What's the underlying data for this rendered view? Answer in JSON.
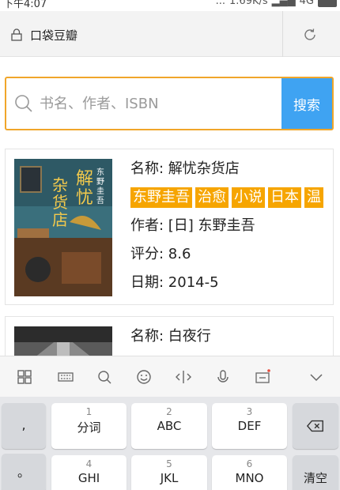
{
  "status_bar": {
    "time": "下午4:07",
    "network_speed": "1.69K/s",
    "network_type": "4G",
    "dots": "..."
  },
  "address_bar": {
    "site_name": "口袋豆瓣"
  },
  "search": {
    "placeholder": "书名、作者、ISBN",
    "button_label": "搜索"
  },
  "colors": {
    "accent_orange": "#f0a62a",
    "tag_orange": "#f6a500",
    "search_button_blue": "#3fa3f2"
  },
  "books": [
    {
      "name_label": "名称: 解忧杂货店",
      "tags": [
        "东野圭吾",
        "治愈",
        "小说",
        "日本",
        "温"
      ],
      "author_label": "作者: [日] 东野圭吾",
      "rating_label": "评分: 8.6",
      "date_label": "日期: 2014-5",
      "cover_title": "解忧杂货店",
      "cover_author": "东野圭吾"
    },
    {
      "name_label": "名称: 白夜行"
    }
  ],
  "keyboard": {
    "toolbar_icons": [
      "grid-icon",
      "keyboard-icon",
      "search-icon",
      "emoji-icon",
      "cursor-icon",
      "microphone-icon",
      "clipboard-icon",
      "collapse-icon"
    ],
    "left_column": [
      ",",
      "。",
      "?"
    ],
    "row1": [
      {
        "num": "1",
        "label": "分词"
      },
      {
        "num": "2",
        "label": "ABC"
      },
      {
        "num": "3",
        "label": "DEF"
      }
    ],
    "row2": [
      {
        "num": "4",
        "label": "GHI"
      },
      {
        "num": "5",
        "label": "JKL"
      },
      {
        "num": "6",
        "label": "MNO"
      }
    ],
    "clear_label": "清空"
  }
}
